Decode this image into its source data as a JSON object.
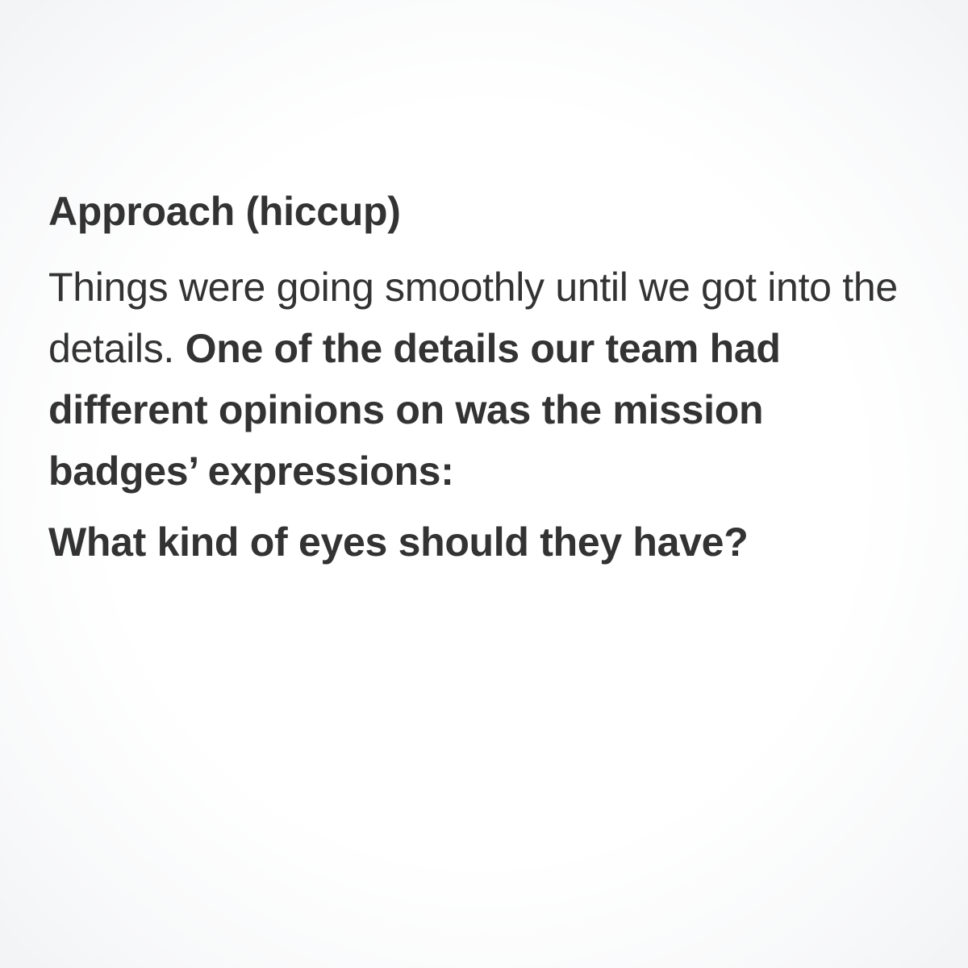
{
  "slide": {
    "heading": "Approach (hiccup)",
    "paragraph": {
      "regular_text": "Things were going smoothly until we got into the details. ",
      "bold_text": "One of the details our team had different opinions on was the mission badges’ expressions:"
    },
    "question": "What kind of eyes should they have?"
  }
}
